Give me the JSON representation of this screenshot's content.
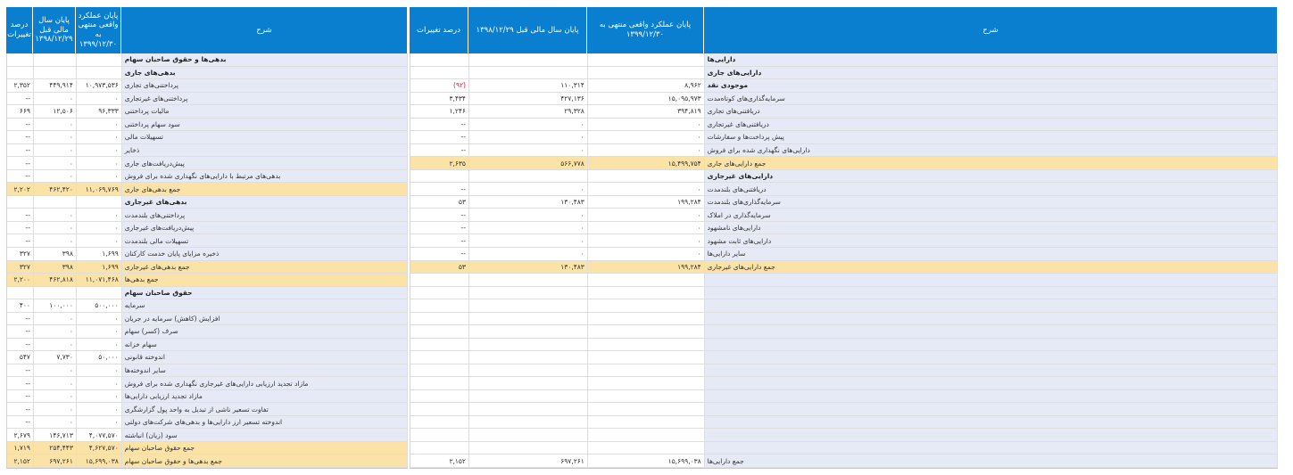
{
  "left_table": {
    "headers": {
      "pct": "درصد تغییرات",
      "prev": "پایان سال مالی قبل ۱۳۹۸/۱۲/۲۹",
      "cur": "پایان عملکرد واقعی منتهی به ۱۳۹۹/۱۲/۳۰",
      "desc": "شرح"
    },
    "rows": [
      {
        "style": "bold",
        "desc": "بدهی‌ها و حقوق صاحبان سهام",
        "cur": "",
        "prev": "",
        "pct": ""
      },
      {
        "style": "sub",
        "desc": "بدهی‌های جاری",
        "cur": "",
        "prev": "",
        "pct": ""
      },
      {
        "style": "",
        "desc": "پرداختنی‌های تجاری",
        "cur": "۱۰,۹۷۳,۵۳۶",
        "prev": "۴۴۹,۹۱۴",
        "pct": "۲,۳۵۲"
      },
      {
        "style": "",
        "desc": "پرداختنی‌های غیرتجاری",
        "cur": "۰",
        "prev": "۰",
        "pct": "--"
      },
      {
        "style": "",
        "desc": "مالیات پرداختنی",
        "cur": "۹۶,۳۳۳",
        "prev": "۱۲,۵۰۶",
        "pct": "۶۶۹"
      },
      {
        "style": "",
        "desc": "سود سهام پرداختنی",
        "cur": "۰",
        "prev": "۰",
        "pct": "--"
      },
      {
        "style": "",
        "desc": "تسهیلات مالی",
        "cur": "۰",
        "prev": "۰",
        "pct": "--"
      },
      {
        "style": "",
        "desc": "ذخایر",
        "cur": "۰",
        "prev": "۰",
        "pct": "--"
      },
      {
        "style": "",
        "desc": "پیش‌دریافت‌های جاری",
        "cur": "۰",
        "prev": "۰",
        "pct": "--"
      },
      {
        "style": "",
        "desc": "بدهی‌های مرتبط با دارایی‌های نگهداری شده برای فروش",
        "cur": "۰",
        "prev": "۰",
        "pct": "--"
      },
      {
        "style": "total",
        "desc": "جمع بدهی‌های جاری",
        "cur": "۱۱,۰۶۹,۷۶۹",
        "prev": "۴۶۲,۴۲۰",
        "pct": "۲,۲۰۲"
      },
      {
        "style": "sub",
        "desc": "بدهی‌های غیرجاری",
        "cur": "",
        "prev": "",
        "pct": ""
      },
      {
        "style": "",
        "desc": "پرداختنی‌های بلندمدت",
        "cur": "۰",
        "prev": "۰",
        "pct": "--"
      },
      {
        "style": "",
        "desc": "پیش‌دریافت‌های غیرجاری",
        "cur": "۰",
        "prev": "۰",
        "pct": "--"
      },
      {
        "style": "",
        "desc": "تسهیلات مالی بلندمدت",
        "cur": "۰",
        "prev": "۰",
        "pct": "--"
      },
      {
        "style": "",
        "desc": "ذخیره مزایای پایان خدمت کارکنان",
        "cur": "۱,۶۹۹",
        "prev": "۳۹۸",
        "pct": "۳۲۷"
      },
      {
        "style": "total",
        "desc": "جمع بدهی‌های غیرجاری",
        "cur": "۱,۶۹۹",
        "prev": "۳۹۸",
        "pct": "۳۲۷"
      },
      {
        "style": "total",
        "desc": "جمع بدهی‌ها",
        "cur": "۱۱,۰۷۱,۴۶۸",
        "prev": "۴۶۲,۸۱۸",
        "pct": "۲,۲۰۰"
      },
      {
        "style": "sub",
        "desc": "حقوق صاحبان سهام",
        "cur": "",
        "prev": "",
        "pct": ""
      },
      {
        "style": "",
        "desc": "سرمایه",
        "cur": "۵۰۰,۰۰۰",
        "prev": "۱۰۰,۰۰۰",
        "pct": "۴۰۰"
      },
      {
        "style": "",
        "desc": "افزایش (کاهش) سرمایه در جریان",
        "cur": "۰",
        "prev": "۰",
        "pct": "--"
      },
      {
        "style": "",
        "desc": "صرف (کسر) سهام",
        "cur": "۰",
        "prev": "۰",
        "pct": "--"
      },
      {
        "style": "",
        "desc": "سهام خزانه",
        "cur": "۰",
        "prev": "۰",
        "pct": "--"
      },
      {
        "style": "",
        "desc": "اندوخته قانونی",
        "cur": "۵۰,۰۰۰",
        "prev": "۷,۷۳۰",
        "pct": "۵۴۷"
      },
      {
        "style": "",
        "desc": "سایر اندوخته‌ها",
        "cur": "۰",
        "prev": "۰",
        "pct": "--"
      },
      {
        "style": "",
        "desc": "مازاد تجدید ارزیابی دارایی‌های غیرجاری نگهداری شده برای فروش",
        "cur": "۰",
        "prev": "۰",
        "pct": "--"
      },
      {
        "style": "",
        "desc": "مازاد تجدید ارزیابی دارایی‌ها",
        "cur": "۰",
        "prev": "۰",
        "pct": "--"
      },
      {
        "style": "",
        "desc": "تفاوت تسعیر ناشی از تبدیل به واحد پول گزارشگری",
        "cur": "۰",
        "prev": "۰",
        "pct": "--"
      },
      {
        "style": "",
        "desc": "اندوخته تسعیر ارز دارایی‌ها و بدهی‌های شرکت‌های دولتی",
        "cur": "۰",
        "prev": "۰",
        "pct": "--"
      },
      {
        "style": "",
        "desc": "سود (زیان) انباشته",
        "cur": "۴,۰۷۷,۵۷۰",
        "prev": "۱۴۶,۷۱۳",
        "pct": "۲,۶۷۹"
      },
      {
        "style": "total",
        "desc": "جمع حقوق صاحبان سهام",
        "cur": "۴,۶۲۷,۵۷۰",
        "prev": "۲۵۴,۴۴۳",
        "pct": "۱,۷۱۹"
      },
      {
        "style": "total",
        "desc": "جمع بدهی‌ها و حقوق صاحبان سهام",
        "cur": "۱۵,۶۹۹,۰۳۸",
        "prev": "۶۹۷,۲۶۱",
        "pct": "۲,۱۵۲"
      }
    ]
  },
  "right_table": {
    "headers": {
      "pct": "درصد تغییرات",
      "prev": "پایان سال مالی قبل ۱۳۹۸/۱۲/۲۹",
      "cur": "پایان عملکرد واقعی منتهی به ۱۳۹۹/۱۲/۳۰",
      "desc": "شرح"
    },
    "rows": [
      {
        "style": "bold",
        "desc": "دارایی‌ها",
        "cur": "",
        "prev": "",
        "pct": ""
      },
      {
        "style": "sub",
        "desc": "دارایی‌های جاری",
        "cur": "",
        "prev": "",
        "pct": ""
      },
      {
        "style": "bold",
        "desc": "موجودی نقد",
        "cur": "۸,۹۶۲",
        "prev": "۱۱۰,۳۱۴",
        "pct": "(۹۲)",
        "neg": true
      },
      {
        "style": "",
        "desc": "سرمایه‌گذاری‌های کوتاه‌مدت",
        "cur": "۱۵,۰۹۵,۹۷۳",
        "prev": "۴۲۷,۱۳۶",
        "pct": "۳,۴۳۴"
      },
      {
        "style": "",
        "desc": "دریافتنی‌های تجاری",
        "cur": "۳۹۴,۸۱۹",
        "prev": "۲۹,۳۲۸",
        "pct": "۱,۲۴۶"
      },
      {
        "style": "",
        "desc": "دریافتنی‌های غیرتجاری",
        "cur": "۰",
        "prev": "۰",
        "pct": "--"
      },
      {
        "style": "",
        "desc": "پیش پرداخت‌ها و سفارشات",
        "cur": "۰",
        "prev": "۰",
        "pct": "--"
      },
      {
        "style": "",
        "desc": "دارایی‌های نگهداری شده برای فروش",
        "cur": "۰",
        "prev": "۰",
        "pct": "--"
      },
      {
        "style": "total",
        "desc": "جمع دارایی‌های جاری",
        "cur": "۱۵,۴۹۹,۷۵۴",
        "prev": "۵۶۶,۷۷۸",
        "pct": "۲,۶۳۵"
      },
      {
        "style": "sub",
        "desc": "دارایی‌های غیرجاری",
        "cur": "",
        "prev": "",
        "pct": ""
      },
      {
        "style": "",
        "desc": "دریافتنی‌های بلندمدت",
        "cur": "۰",
        "prev": "۰",
        "pct": "--"
      },
      {
        "style": "",
        "desc": "سرمایه‌گذاری‌های بلندمدت",
        "cur": "۱۹۹,۲۸۴",
        "prev": "۱۳۰,۴۸۳",
        "pct": "۵۳"
      },
      {
        "style": "",
        "desc": "سرمایه‌گذاری در املاک",
        "cur": "۰",
        "prev": "۰",
        "pct": "--"
      },
      {
        "style": "",
        "desc": "دارایی‌های نامشهود",
        "cur": "۰",
        "prev": "۰",
        "pct": "--"
      },
      {
        "style": "",
        "desc": "دارایی‌های ثابت مشهود",
        "cur": "۰",
        "prev": "۰",
        "pct": "--"
      },
      {
        "style": "",
        "desc": "سایر دارایی‌ها",
        "cur": "۰",
        "prev": "۰",
        "pct": "--"
      },
      {
        "style": "total",
        "desc": "جمع دارایی‌های غیرجاری",
        "cur": "۱۹۹,۲۸۴",
        "prev": "۱۳۰,۴۸۳",
        "pct": "۵۳"
      },
      {
        "style": "",
        "desc": "",
        "cur": "",
        "prev": "",
        "pct": ""
      },
      {
        "style": "",
        "desc": "",
        "cur": "",
        "prev": "",
        "pct": ""
      },
      {
        "style": "",
        "desc": "",
        "cur": "",
        "prev": "",
        "pct": ""
      },
      {
        "style": "",
        "desc": "",
        "cur": "",
        "prev": "",
        "pct": ""
      },
      {
        "style": "",
        "desc": "",
        "cur": "",
        "prev": "",
        "pct": ""
      },
      {
        "style": "",
        "desc": "",
        "cur": "",
        "prev": "",
        "pct": ""
      },
      {
        "style": "",
        "desc": "",
        "cur": "",
        "prev": "",
        "pct": ""
      },
      {
        "style": "",
        "desc": "",
        "cur": "",
        "prev": "",
        "pct": ""
      },
      {
        "style": "",
        "desc": "",
        "cur": "",
        "prev": "",
        "pct": ""
      },
      {
        "style": "",
        "desc": "",
        "cur": "",
        "prev": "",
        "pct": ""
      },
      {
        "style": "",
        "desc": "",
        "cur": "",
        "prev": "",
        "pct": ""
      },
      {
        "style": "",
        "desc": "",
        "cur": "",
        "prev": "",
        "pct": ""
      },
      {
        "style": "",
        "desc": "",
        "cur": "",
        "prev": "",
        "pct": ""
      },
      {
        "style": "",
        "desc": "",
        "cur": "",
        "prev": "",
        "pct": ""
      },
      {
        "style": "total-plain",
        "desc": "جمع دارایی‌ها",
        "cur": "۱۵,۶۹۹,۰۳۸",
        "prev": "۶۹۷,۲۶۱",
        "pct": "۲,۱۵۲"
      }
    ]
  },
  "colors": {
    "header_bg": "#0a7fcf",
    "desc_bg": "#e6eaf6",
    "total_bg": "#fbe2a6",
    "negative": "#d23"
  }
}
